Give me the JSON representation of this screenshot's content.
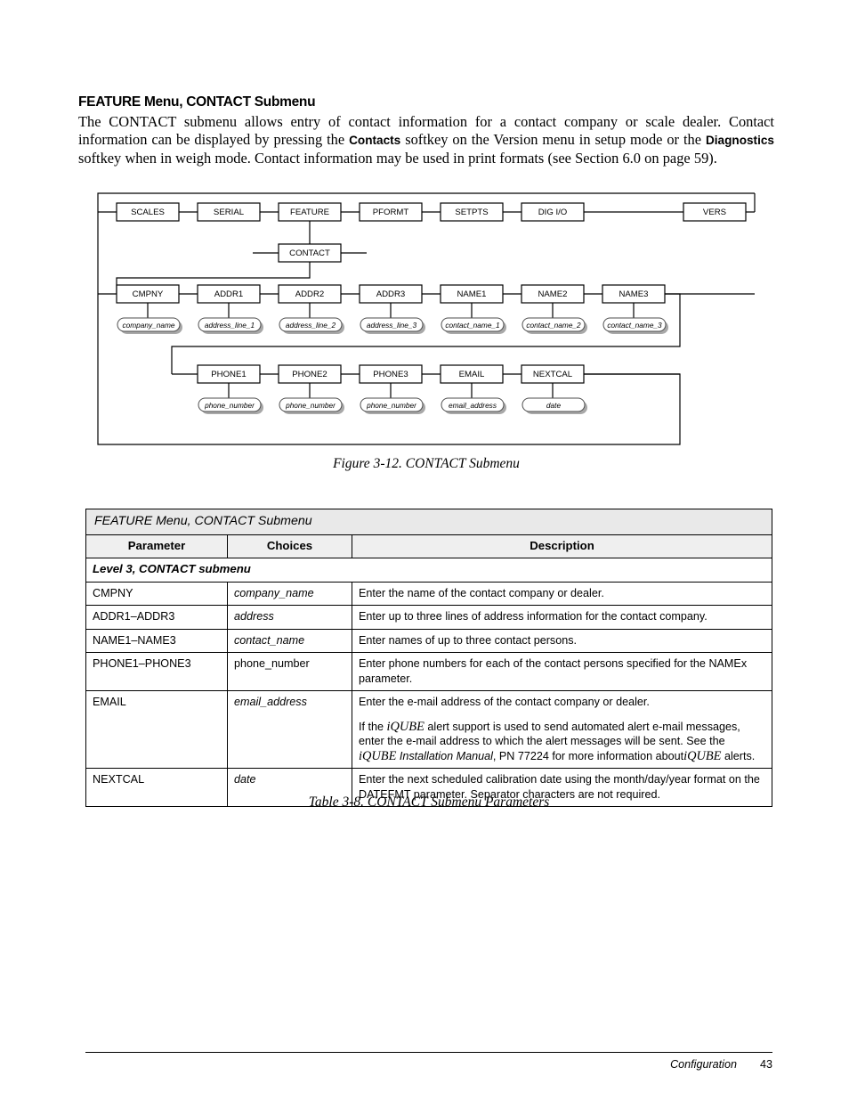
{
  "section": {
    "heading": "FEATURE Menu, CONTACT Submenu",
    "paragraph_part1": "The CONTACT submenu allows entry of contact information for a contact company or scale dealer. Contact information can be displayed by pressing the ",
    "softkey1": "Contacts",
    "paragraph_part2": " softkey on the Version menu in setup mode or the ",
    "softkey2": "Diagnostics",
    "paragraph_part3": " softkey when in weigh mode. Contact information may be used in print formats (see Section 6.0 on page 59)."
  },
  "figure": {
    "caption": "Figure 3-12. CONTACT Submenu",
    "top_row": [
      "SCALES",
      "SERIAL",
      "FEATURE",
      "PFORMT",
      "SETPTS",
      "DIG I/O",
      "VERS"
    ],
    "level2": "CONTACT",
    "row2_nodes": [
      "CMPNY",
      "ADDR1",
      "ADDR2",
      "ADDR3",
      "NAME1",
      "NAME2",
      "NAME3"
    ],
    "row2_values": [
      "company_name",
      "address_line_1",
      "address_line_2",
      "address_line_3",
      "contact_name_1",
      "contact_name_2",
      "contact_name_3"
    ],
    "row3_nodes": [
      "PHONE1",
      "PHONE2",
      "PHONE3",
      "EMAIL",
      "NEXTCAL"
    ],
    "row3_values": [
      "phone_number",
      "phone_number",
      "phone_number",
      "email_address",
      "date"
    ]
  },
  "table": {
    "title": "FEATURE Menu, CONTACT Submenu",
    "headers": [
      "Parameter",
      "Choices",
      "Description"
    ],
    "subhead": "Level 3, CONTACT submenu",
    "caption": "Table 3-8. CONTACT Submenu Parameters",
    "rows": [
      {
        "parameter": "CMPNY",
        "choices": "company_name",
        "choices_italic": true,
        "desc1": "Enter the name of the contact company or dealer."
      },
      {
        "parameter": "ADDR1–ADDR3",
        "choices": "address",
        "choices_italic": true,
        "desc1": "Enter up to three lines of address information for the contact company."
      },
      {
        "parameter": "NAME1–NAME3",
        "choices": "contact_name",
        "choices_italic": true,
        "desc1": "Enter names of up to three contact persons."
      },
      {
        "parameter": "PHONE1–PHONE3",
        "choices": "phone_number",
        "choices_italic": false,
        "desc1": "Enter phone numbers for each of the contact persons specified for the NAMEx parameter."
      },
      {
        "parameter": "EMAIL",
        "choices": "email_address",
        "choices_italic": true,
        "desc1": "Enter the e-mail address of the contact company or dealer.",
        "desc2_a": "If the ",
        "desc2_iqube1": "iQUBE",
        "desc2_b": " alert support is used to send automated alert e-mail messages, enter the e-mail address to which the alert messages will be sent. See the ",
        "desc2_iqube2": "iQUBE",
        "desc2_c": " ",
        "desc2_manual": "Installation Manual",
        "desc2_d": ", PN 77224 for more information about",
        "desc2_iqube3": "iQUBE",
        "desc2_e": " alerts."
      },
      {
        "parameter": "NEXTCAL",
        "choices": "date",
        "choices_italic": true,
        "desc1": "Enter the next scheduled calibration date using the month/day/year format on the DATEFMT parameter. Separator characters are not required."
      }
    ]
  },
  "footer": {
    "chapter": "Configuration",
    "page": "43"
  }
}
